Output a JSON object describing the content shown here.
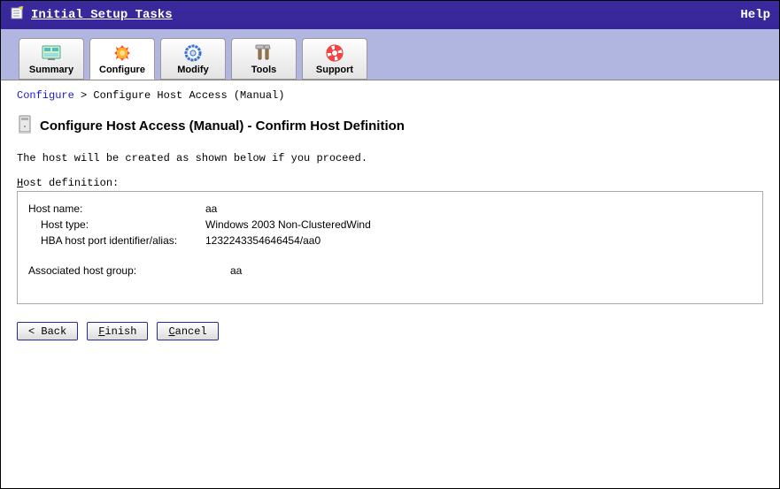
{
  "titlebar": {
    "title": "Initial Setup Tasks",
    "help": "Help"
  },
  "tabs": [
    {
      "label": "Summary"
    },
    {
      "label": "Configure"
    },
    {
      "label": "Modify"
    },
    {
      "label": "Tools"
    },
    {
      "label": "Support"
    }
  ],
  "breadcrumb": {
    "root": "Configure",
    "sep": ">",
    "current": "Configure Host Access (Manual)"
  },
  "heading": "Configure Host Access (Manual) - Confirm Host Definition",
  "intro": "The host will be created as shown below if you proceed.",
  "section_label_prefix": "H",
  "section_label_rest": "ost definition:",
  "definition": {
    "rows": [
      {
        "label": "Host name:",
        "value": "aa",
        "indent": false
      },
      {
        "label": "Host type:",
        "value": "Windows 2003 Non-ClusteredWind",
        "indent": true
      },
      {
        "label": "HBA host port identifier/alias:",
        "value": "1232243354646454/aa0",
        "indent": true
      }
    ],
    "assoc_label": "Associated host group:",
    "assoc_value": "aa"
  },
  "buttons": {
    "back": "< Back",
    "finish_u": "F",
    "finish_rest": "inish",
    "cancel_u": "C",
    "cancel_rest": "ancel"
  }
}
